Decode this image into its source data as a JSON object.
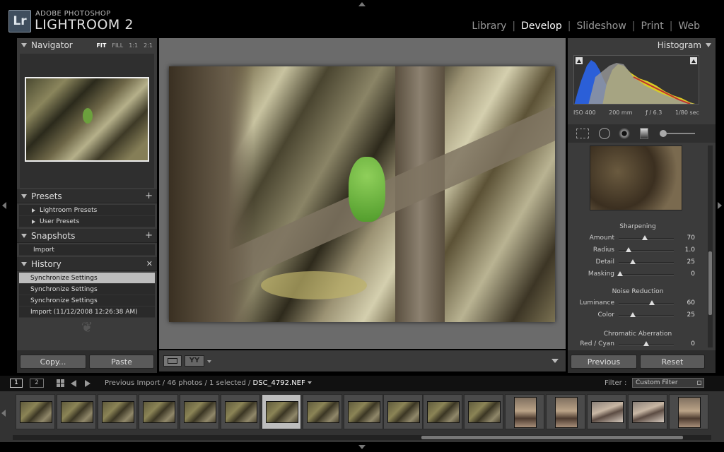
{
  "app": {
    "logo_mark": "Lr",
    "brand": "ADOBE PHOTOSHOP",
    "product": "LIGHTROOM 2"
  },
  "modules": [
    {
      "label": "Library",
      "active": false
    },
    {
      "label": "Develop",
      "active": true
    },
    {
      "label": "Slideshow",
      "active": false
    },
    {
      "label": "Print",
      "active": false
    },
    {
      "label": "Web",
      "active": false
    }
  ],
  "navigator": {
    "title": "Navigator",
    "zoom": [
      "FIT",
      "FILL",
      "1:1",
      "2:1"
    ],
    "active_zoom": "FIT"
  },
  "presets": {
    "title": "Presets",
    "items": [
      "Lightroom Presets",
      "User Presets"
    ]
  },
  "snapshots": {
    "title": "Snapshots",
    "items": [
      "Import"
    ]
  },
  "history": {
    "title": "History",
    "items": [
      "Synchronize Settings",
      "Synchronize Settings",
      "Synchronize Settings",
      "Import (11/12/2008 12:26:38 AM)"
    ]
  },
  "left_buttons": {
    "copy": "Copy...",
    "paste": "Paste"
  },
  "histogram": {
    "title": "Histogram",
    "iso": "ISO 400",
    "focal": "200 mm",
    "aperture": "ƒ / 6.3",
    "shutter": "1/80 sec"
  },
  "sharpening": {
    "title": "Sharpening",
    "sliders": [
      {
        "label": "Amount",
        "value": "70",
        "pos": 0.47
      },
      {
        "label": "Radius",
        "value": "1.0",
        "pos": 0.18
      },
      {
        "label": "Detail",
        "value": "25",
        "pos": 0.25
      },
      {
        "label": "Masking",
        "value": "0",
        "pos": 0.02
      }
    ]
  },
  "noise": {
    "title": "Noise Reduction",
    "sliders": [
      {
        "label": "Luminance",
        "value": "60",
        "pos": 0.6
      },
      {
        "label": "Color",
        "value": "25",
        "pos": 0.25
      }
    ]
  },
  "chromatic": {
    "title": "Chromatic Aberration",
    "sliders": [
      {
        "label": "Red / Cyan",
        "value": "0",
        "pos": 0.5
      }
    ]
  },
  "right_buttons": {
    "previous": "Previous",
    "reset": "Reset"
  },
  "filmbar": {
    "screen1": "1",
    "screen2": "2",
    "path": "Previous Import / 46 photos / 1 selected /",
    "filename": "DSC_4792.NEF",
    "filter_label": "Filter :",
    "filter_value": "Custom Filter"
  },
  "colors": {
    "accent_selected": "#bdbdbd",
    "panel": "#3b3b3b",
    "background": "#000000"
  }
}
